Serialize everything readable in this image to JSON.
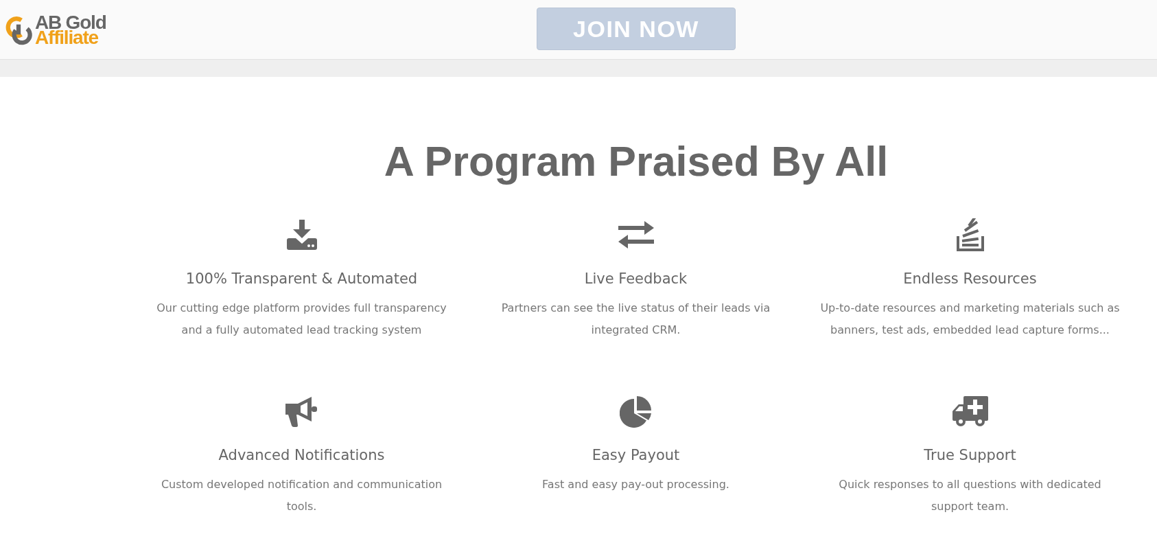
{
  "header": {
    "logo": {
      "top_line": "AB Gold",
      "bottom_line": "Affiliate"
    },
    "join_button": "JOIN NOW"
  },
  "section": {
    "title": "A Program Praised By All",
    "features": [
      {
        "title": "100% Transparent & Automated",
        "description": "Our cutting edge platform provides full transparency and a fully automated lead tracking system"
      },
      {
        "title": "Live Feedback",
        "description": "Partners can see the live status of their leads via integrated CRM."
      },
      {
        "title": "Endless Resources",
        "description": "Up-to-date resources and marketing materials such as banners, test ads, embedded lead capture forms..."
      },
      {
        "title": "Advanced Notifications",
        "description": "Custom developed notification and communication tools."
      },
      {
        "title": "Easy Payout",
        "description": "Fast and easy pay-out processing."
      },
      {
        "title": "True Support",
        "description": "Quick responses to all questions with dedicated support team."
      }
    ]
  }
}
